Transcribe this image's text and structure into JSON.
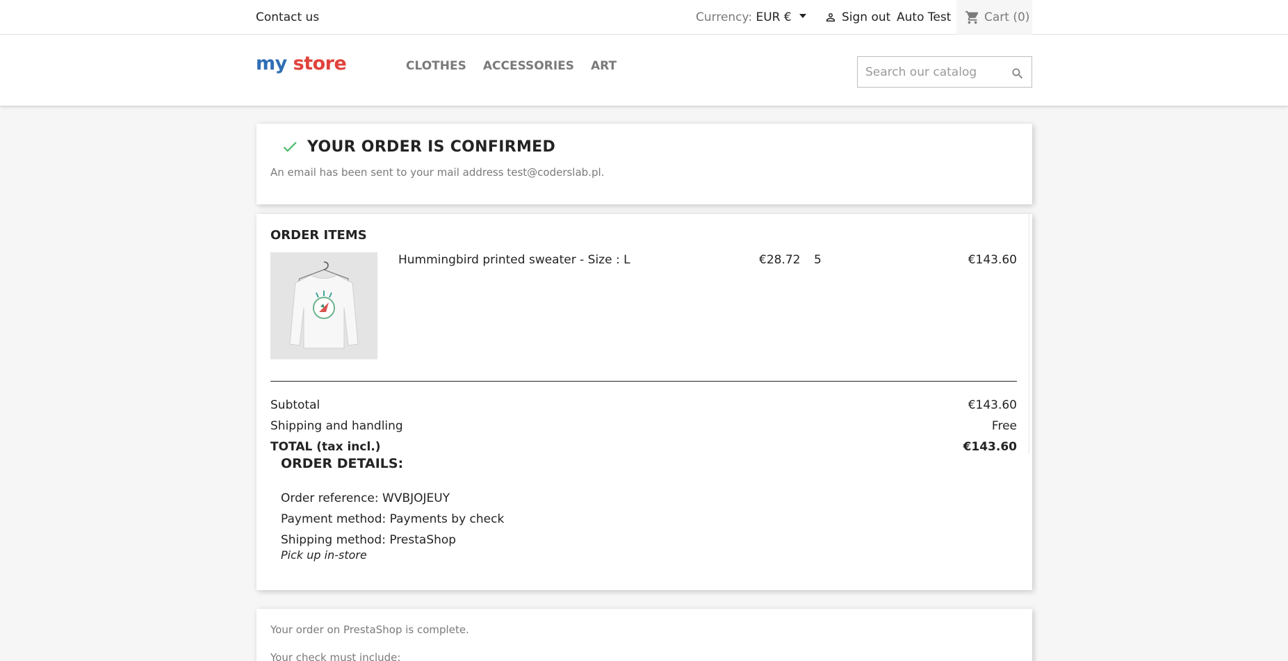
{
  "topbar": {
    "contact": "Contact us",
    "currency_label": "Currency:",
    "currency_value": "EUR €",
    "sign_out": "Sign out",
    "account_name": "Auto Test",
    "cart": "Cart (0)"
  },
  "header": {
    "logo": {
      "word1": "my",
      "word2": "store"
    },
    "nav": [
      "CLOTHES",
      "ACCESSORIES",
      "ART"
    ],
    "search_placeholder": "Search our catalog"
  },
  "confirmation": {
    "title": "YOUR ORDER IS CONFIRMED",
    "subtitle": "An email has been sent to your mail address test@coderslab.pl."
  },
  "order_items": {
    "title": "ORDER ITEMS",
    "items": [
      {
        "name": "Hummingbird printed sweater - Size : L",
        "unit_price": "€28.72",
        "quantity": "5",
        "total": "€143.60"
      }
    ],
    "subtotal_label": "Subtotal",
    "subtotal_value": "€143.60",
    "shipping_label": "Shipping and handling",
    "shipping_value": "Free",
    "total_label": "TOTAL (tax incl.)",
    "total_value": "€143.60"
  },
  "order_details": {
    "title": "ORDER DETAILS:",
    "reference": "Order reference: WVBJOJEUY",
    "payment": "Payment method: Payments by check",
    "shipping": "Shipping method: PrestaShop",
    "shipping_note": "Pick up in-store"
  },
  "payment_info": {
    "line1": "Your order on PrestaShop is complete.",
    "line2": "Your check must include:"
  },
  "colors": {
    "accent_check": "#4cbb6c",
    "muted": "#7a7a7a",
    "text": "#232323"
  }
}
